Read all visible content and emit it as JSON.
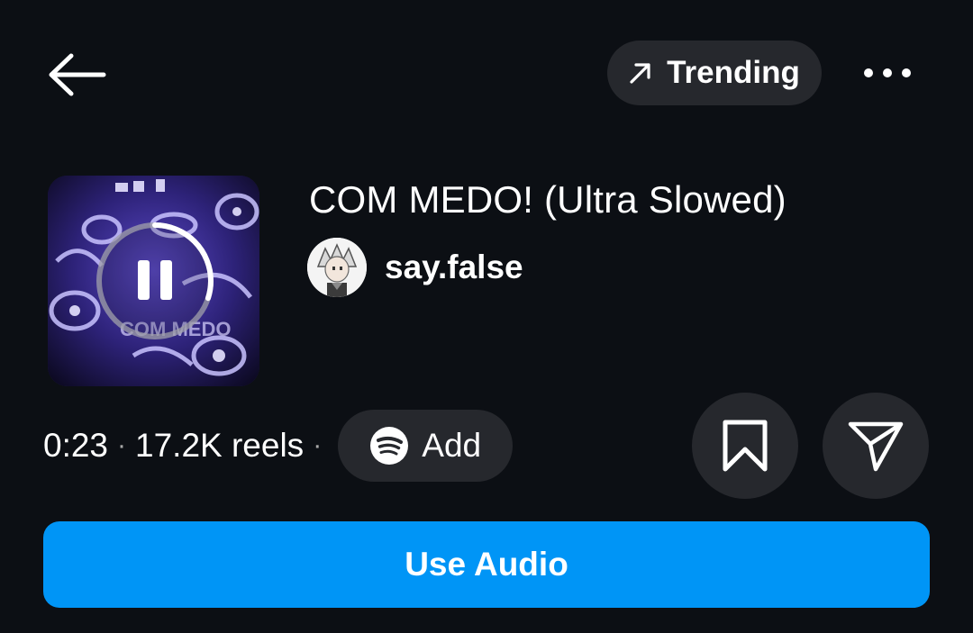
{
  "header": {
    "back_icon": "arrow-left-icon",
    "trending_icon": "trend-arrow-icon",
    "trending_label": "Trending",
    "more_icon": "more-horizontal-icon"
  },
  "track": {
    "title": "COM MEDO! (Ultra Slowed)",
    "artist": "say.false",
    "cover_text": "COM MEDO",
    "playback_state": "playing",
    "control_icon": "pause-icon",
    "playback_progress": 0.3
  },
  "meta": {
    "duration": "0:23",
    "separator": "·",
    "reels_count": "17.2K reels",
    "add_icon": "spotify-icon",
    "add_label": "Add"
  },
  "actions": {
    "save_icon": "bookmark-icon",
    "share_icon": "send-icon",
    "use_audio_label": "Use Audio"
  },
  "colors": {
    "background": "#0c0f14",
    "pill_background": "#26282d",
    "primary_button": "#0095f6",
    "text": "#ffffff"
  }
}
